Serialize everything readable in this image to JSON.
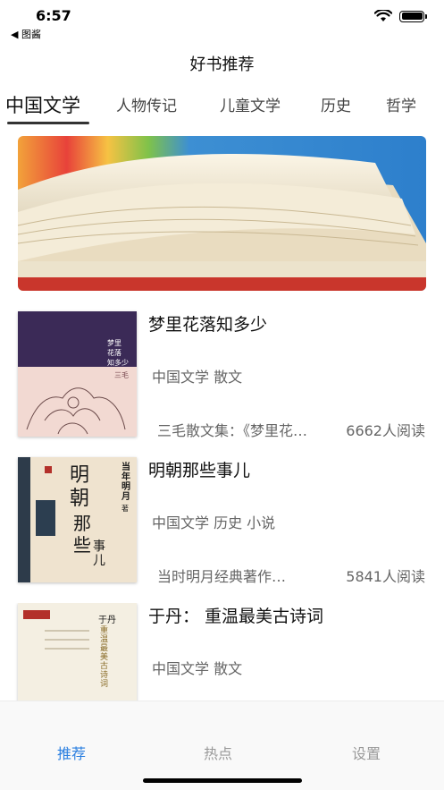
{
  "status": {
    "time": "6:57",
    "back_label": "◀ 图酱"
  },
  "nav": {
    "title": "好书推荐"
  },
  "tabs": [
    {
      "label": "中国文学",
      "active": true
    },
    {
      "label": "人物传记"
    },
    {
      "label": "儿童文学"
    },
    {
      "label": "历史"
    },
    {
      "label": "哲学"
    }
  ],
  "books": [
    {
      "title": "梦里花落知多少",
      "tags": "中国文学 散文",
      "desc": "三毛散文集：《梦里花落知多少》",
      "readers": "6662人阅读",
      "cover_text": [
        "梦里",
        "花落",
        "知多少",
        "三毛"
      ]
    },
    {
      "title": "明朝那些事儿",
      "tags": "中国文学 历史 小说",
      "desc": "当时明月经典著作…",
      "readers": "5841人阅读",
      "cover_text": [
        "明朝",
        "那些",
        "事儿",
        "当年明月",
        "著"
      ]
    },
    {
      "title": "于丹：  重温最美古诗词",
      "tags": "中国文学 散文",
      "cover_text": [
        "于丹",
        "重温最美古诗词"
      ]
    }
  ],
  "tabbar": [
    {
      "label": "推荐",
      "active": true
    },
    {
      "label": "热点"
    },
    {
      "label": "设置"
    }
  ],
  "colors": {
    "accent": "#2b7fe0"
  }
}
